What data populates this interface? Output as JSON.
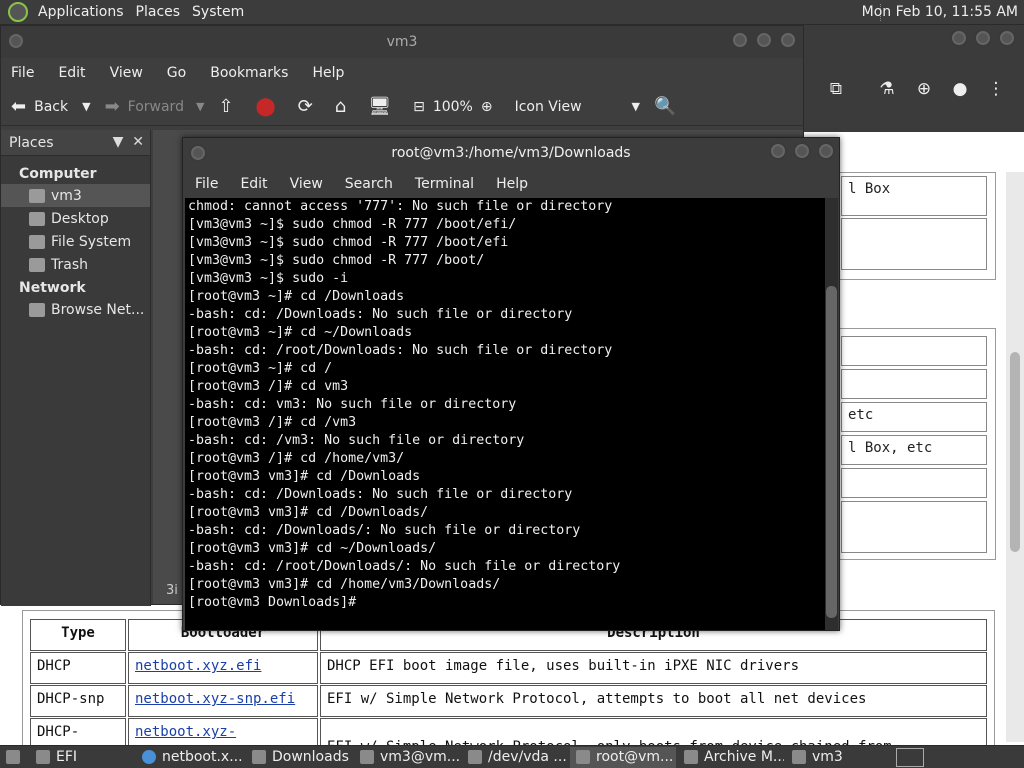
{
  "top_panel": {
    "menus": [
      "Applications",
      "Places",
      "System"
    ],
    "clock": "Mon Feb 10, 11:55 AM"
  },
  "browser": {
    "icons": [
      "extension-icon",
      "labs-icon",
      "download-icon",
      "profile-icon",
      "kebab-menu-icon"
    ],
    "page_fragments": {
      "box1": "l Box",
      "row_etc": "etc",
      "row_box_etc": "l Box, etc"
    },
    "table": {
      "headers": [
        "Type",
        "Bootloader",
        "Description"
      ],
      "rows": [
        [
          "DHCP",
          "netboot.xyz.efi",
          "DHCP EFI boot image file, uses built-in iPXE NIC drivers"
        ],
        [
          "DHCP-snp",
          "netboot.xyz-snp.efi",
          "EFI w/ Simple Network Protocol, attempts to boot all net devices"
        ],
        [
          "DHCP-",
          "netboot.xyz-",
          "EFI w/ Simple Network Protocol, only boots from device chained from"
        ]
      ]
    }
  },
  "file_manager": {
    "title": "vm3",
    "menus": [
      "File",
      "Edit",
      "View",
      "Go",
      "Bookmarks",
      "Help"
    ],
    "toolbar": {
      "back": "Back",
      "forward": "Forward",
      "zoom": "100%",
      "view_mode": "Icon View"
    },
    "sidebar": {
      "header": "Places",
      "sections": [
        {
          "title": "Computer",
          "items": [
            "vm3",
            "Desktop",
            "File System",
            "Trash"
          ]
        },
        {
          "title": "Network",
          "items": [
            "Browse Net..."
          ]
        }
      ],
      "selected": "vm3"
    },
    "status": "3i"
  },
  "terminal": {
    "title": "root@vm3:/home/vm3/Downloads",
    "menus": [
      "File",
      "Edit",
      "View",
      "Search",
      "Terminal",
      "Help"
    ],
    "lines": [
      "chmod: cannot access '777': No such file or directory",
      "[vm3@vm3 ~]$ sudo chmod -R 777 /boot/efi/",
      "[vm3@vm3 ~]$ sudo chmod -R 777 /boot/efi",
      "[vm3@vm3 ~]$ sudo chmod -R 777 /boot/",
      "[vm3@vm3 ~]$ sudo -i",
      "[root@vm3 ~]# cd /Downloads",
      "-bash: cd: /Downloads: No such file or directory",
      "[root@vm3 ~]# cd ~/Downloads",
      "-bash: cd: /root/Downloads: No such file or directory",
      "[root@vm3 ~]# cd /",
      "[root@vm3 /]# cd vm3",
      "-bash: cd: vm3: No such file or directory",
      "[root@vm3 /]# cd /vm3",
      "-bash: cd: /vm3: No such file or directory",
      "[root@vm3 /]# cd /home/vm3/",
      "[root@vm3 vm3]# cd /Downloads",
      "-bash: cd: /Downloads: No such file or directory",
      "[root@vm3 vm3]# cd /Downloads/",
      "-bash: cd: /Downloads/: No such file or directory",
      "[root@vm3 vm3]# cd ~/Downloads/",
      "-bash: cd: /root/Downloads/: No such file or directory",
      "[root@vm3 vm3]# cd /home/vm3/Downloads/",
      "[root@vm3 Downloads]# "
    ]
  },
  "taskbar": {
    "tasks": [
      "EFI",
      "netboot.x...",
      "Downloads",
      "vm3@vm...",
      "/dev/vda ...",
      "root@vm...",
      "Archive M...",
      "vm3"
    ],
    "active": "root@vm..."
  }
}
